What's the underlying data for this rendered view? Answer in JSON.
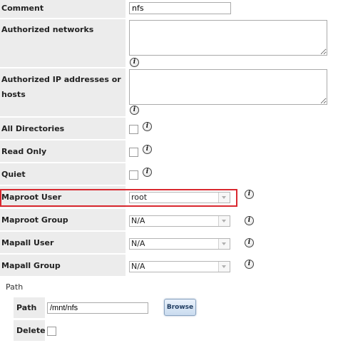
{
  "fields": {
    "comment": {
      "label": "Comment",
      "value": "nfs"
    },
    "authorized_networks": {
      "label": "Authorized networks"
    },
    "authorized_ips": {
      "label": "Authorized IP addresses or hosts"
    },
    "all_directories": {
      "label": "All Directories",
      "checked": false
    },
    "read_only": {
      "label": "Read Only",
      "checked": false
    },
    "quiet": {
      "label": "Quiet",
      "checked": false
    },
    "maproot_user": {
      "label": "Maproot User",
      "value": "root"
    },
    "maproot_group": {
      "label": "Maproot Group",
      "value": "N/A"
    },
    "mapall_user": {
      "label": "Mapall User",
      "value": "N/A"
    },
    "mapall_group": {
      "label": "Mapall Group",
      "value": "N/A"
    }
  },
  "info_glyph": "i",
  "info_icon": "info-icon",
  "paths": {
    "legend": "Path",
    "path_label": "Path",
    "path_value": "/mnt/nfs",
    "browse_label": "Browse",
    "delete_label": "Delete",
    "delete_checked": false
  },
  "colors": {
    "highlight": "#d9282f",
    "label_bg": "#ececec"
  }
}
